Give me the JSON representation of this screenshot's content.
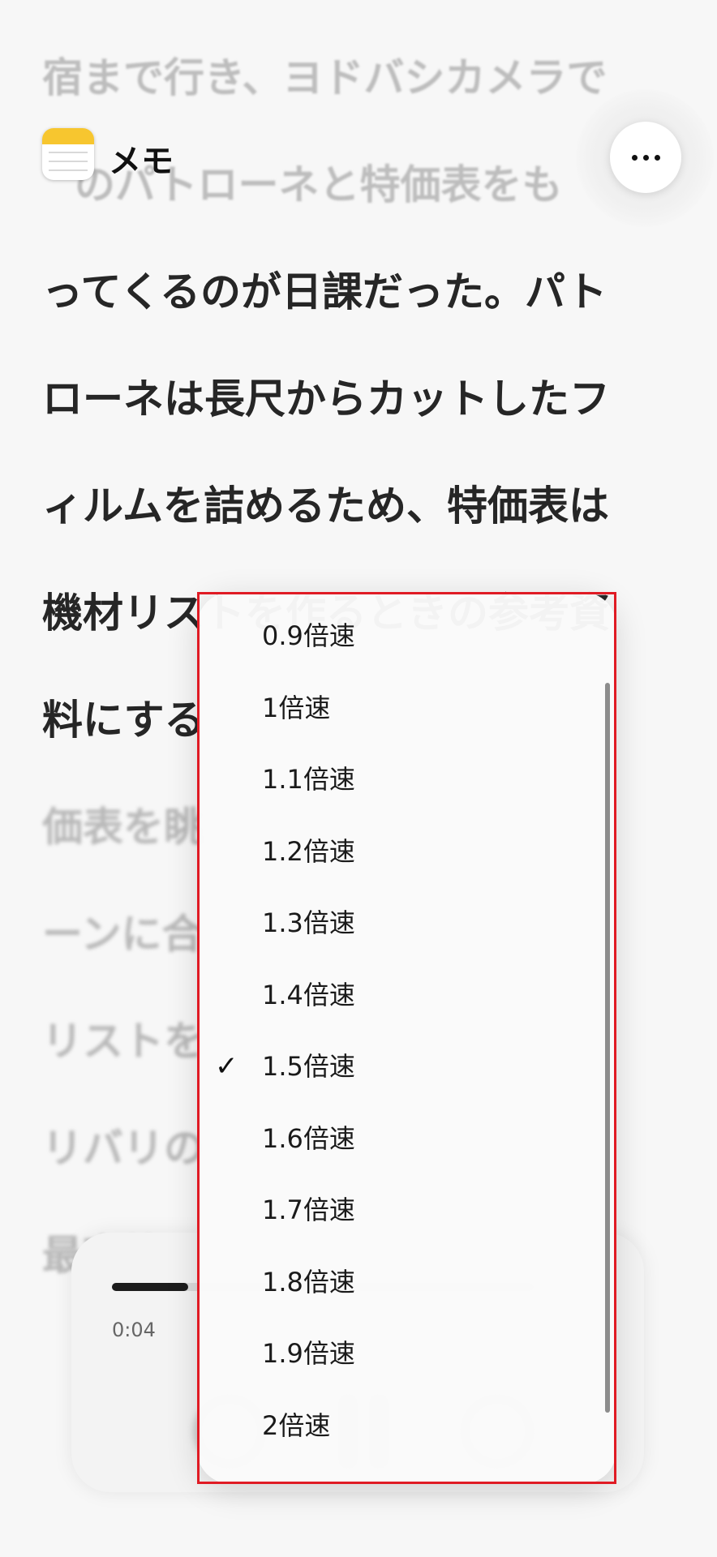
{
  "header": {
    "app_name": "メモ",
    "icon": "notes-app-icon",
    "menu_icon": "more-horizontal-icon"
  },
  "note": {
    "lines": [
      "宿まで行き、ヨドバシカメラで",
      "のパトローネと特価表をも",
      "ってくるのが日課だった。パト",
      "ローネは長尺からカットしたフ",
      "ィルムを詰めるため、特価表は",
      "機材リストを作るときの参考資",
      "料にする",
      "価表を眺",
      "ーンに合",
      "リストを",
      "リバリの",
      "最高峰の"
    ]
  },
  "player": {
    "elapsed": "0:04",
    "progress": 0.18
  },
  "speed_menu": {
    "selected": "1.5倍速",
    "check_mark": "✓",
    "options": [
      "0.9倍速",
      "1倍速",
      "1.1倍速",
      "1.2倍速",
      "1.3倍速",
      "1.4倍速",
      "1.5倍速",
      "1.6倍速",
      "1.7倍速",
      "1.8倍速",
      "1.9倍速",
      "2倍速"
    ]
  }
}
